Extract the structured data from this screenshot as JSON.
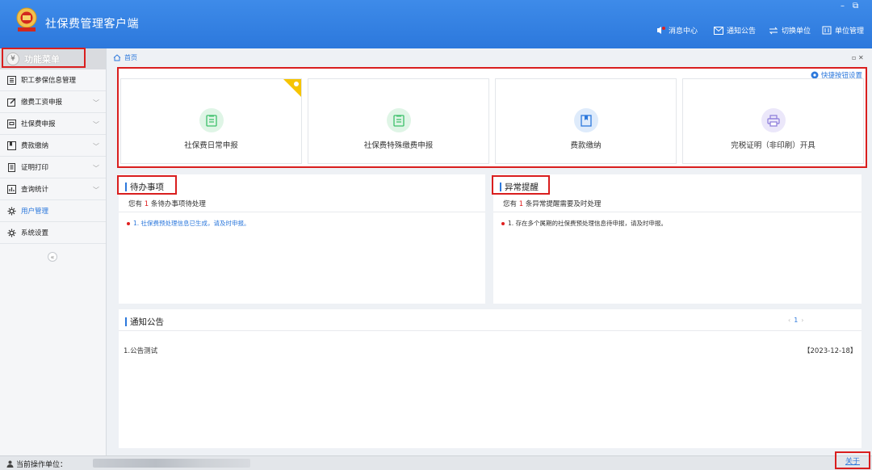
{
  "app": {
    "title": "社保费管理客户端",
    "logo_text": "中国税务"
  },
  "window": {
    "minimize": "–",
    "restore": "⧉"
  },
  "header_menu": [
    {
      "label": "消息中心",
      "icon": "bell-icon"
    },
    {
      "label": "通知公告",
      "icon": "mail-icon"
    },
    {
      "label": "切换单位",
      "icon": "switch-icon"
    },
    {
      "label": "单位管理",
      "icon": "building-icon"
    }
  ],
  "sidebar": {
    "title": "功能菜单",
    "title_icon": "¥",
    "items": [
      {
        "label": "职工参保信息管理",
        "icon": "list-icon",
        "has_arrow": false
      },
      {
        "label": "缴费工资申报",
        "icon": "edit-icon",
        "has_arrow": true
      },
      {
        "label": "社保费申报",
        "icon": "form-icon",
        "has_arrow": true
      },
      {
        "label": "费款缴纳",
        "icon": "book-icon",
        "has_arrow": true
      },
      {
        "label": "证明打印",
        "icon": "doc-icon",
        "has_arrow": true
      },
      {
        "label": "查询统计",
        "icon": "chart-icon",
        "has_arrow": true
      },
      {
        "label": "用户管理",
        "icon": "gear-icon",
        "has_arrow": false,
        "active": true
      },
      {
        "label": "系统设置",
        "icon": "gear-icon",
        "has_arrow": false
      }
    ],
    "collapse_glyph": "«"
  },
  "breadcrumb": {
    "label": "首页"
  },
  "quick": {
    "settings_label": "快捷按钮设置",
    "cards": [
      {
        "label": "社保费日常申报",
        "color": "#3cc06a",
        "bg": "#dff5e6"
      },
      {
        "label": "社保费特殊缴费申报",
        "color": "#3cc06a",
        "bg": "#dff5e6"
      },
      {
        "label": "费款缴纳",
        "color": "#2c78dc",
        "bg": "#deebfb"
      },
      {
        "label": "完税证明（非印刷）开具",
        "color": "#8a7ad9",
        "bg": "#ebe7fa"
      }
    ]
  },
  "todo": {
    "title": "待办事项",
    "summary_pre": "您有 ",
    "summary_num": "1",
    "summary_post": " 条待办事项待处理",
    "item": "1. 社保费预处理信息已生成，请及时申报。"
  },
  "alert": {
    "title": "异常提醒",
    "summary_pre": "您有 ",
    "summary_num": "1",
    "summary_post": " 条异常提醒需要及时处理",
    "item": "1. 存在多个属期的社保费预处理信息待申报，请及时申报。"
  },
  "notice": {
    "title": "通知公告",
    "pager_prev": "‹",
    "pager_current": "1",
    "pager_next": "›",
    "row": "1.公告测试",
    "date": "【2023-12-18】"
  },
  "status": {
    "label": "当前操作单位：",
    "about": "关于"
  },
  "colors": {
    "accent": "#2c78dc",
    "highlight": "#d91e1e",
    "alert_dot": "#e02020",
    "corner": "#f6c400"
  }
}
